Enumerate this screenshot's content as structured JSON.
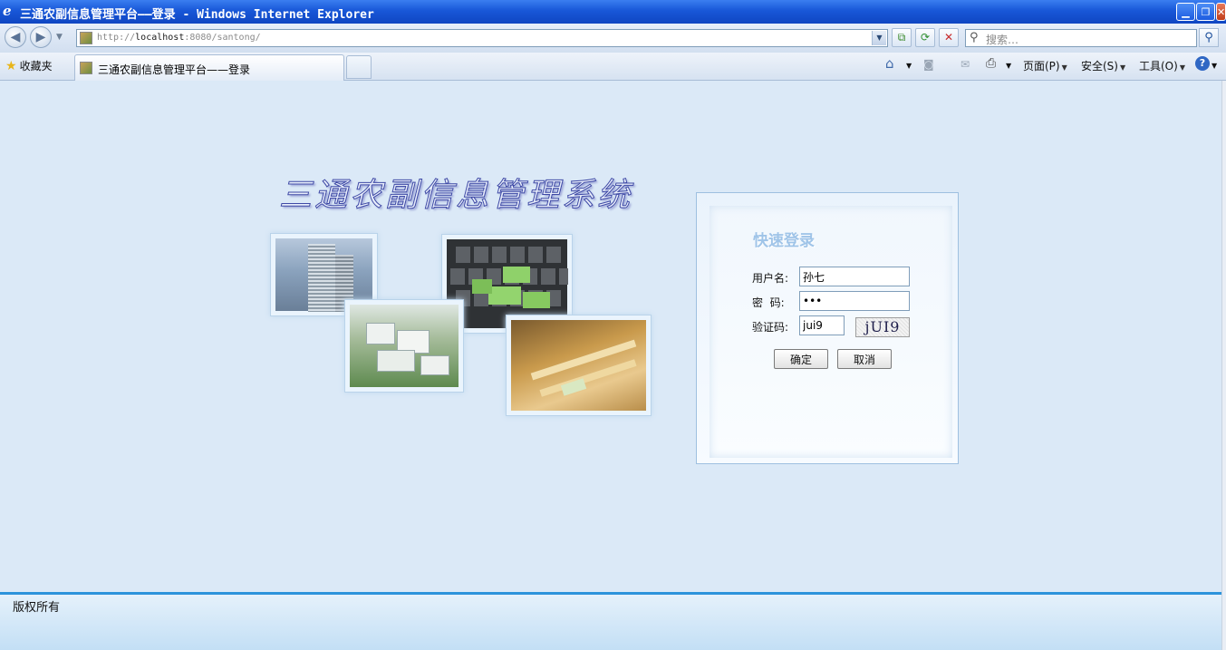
{
  "window": {
    "title": "三通农副信息管理平台——登录 - Windows Internet Explorer",
    "minimize_glyph": "▁",
    "restore_glyph": "❐",
    "close_glyph": "✕"
  },
  "navbar": {
    "back_glyph": "◀",
    "forward_glyph": "▶",
    "url_prefix": "http://",
    "url_host": "localhost",
    "url_rest": ":8080/santong/",
    "search_placeholder": "搜索…",
    "search_glyph": "⚲",
    "compat_glyph": "⧉",
    "refresh_glyph": "⟳",
    "stop_glyph": "✕",
    "dropdown_glyph": "▼"
  },
  "tabbar": {
    "favorites_label": "收藏夹",
    "active_tab_label": "三通农副信息管理平台——登录",
    "tools": {
      "home_glyph": "⌂",
      "feeds_glyph": "◙",
      "mail_glyph": "✉",
      "print_glyph": "⎙",
      "page_label": "页面(P)",
      "safety_label": "安全(S)",
      "tools_label": "工具(O)",
      "help_glyph": "?"
    }
  },
  "page": {
    "banner_text": "三通农副信息管理系统"
  },
  "login": {
    "heading": "快速登录",
    "username_label": "用户名:",
    "username_value": "孙七",
    "password_label": "密  码:",
    "password_value": "sun",
    "captcha_label": "验证码:",
    "captcha_input_value": "jui9",
    "captcha_image_text": "jUI9",
    "ok_label": "确定",
    "cancel_label": "取消"
  },
  "footer": {
    "copyright": "版权所有"
  },
  "colors": {
    "page_bg": "#dbe9f7",
    "footer_line": "#2d93db",
    "heading": "#9fc4e8",
    "titlebar": "#1857d8"
  }
}
